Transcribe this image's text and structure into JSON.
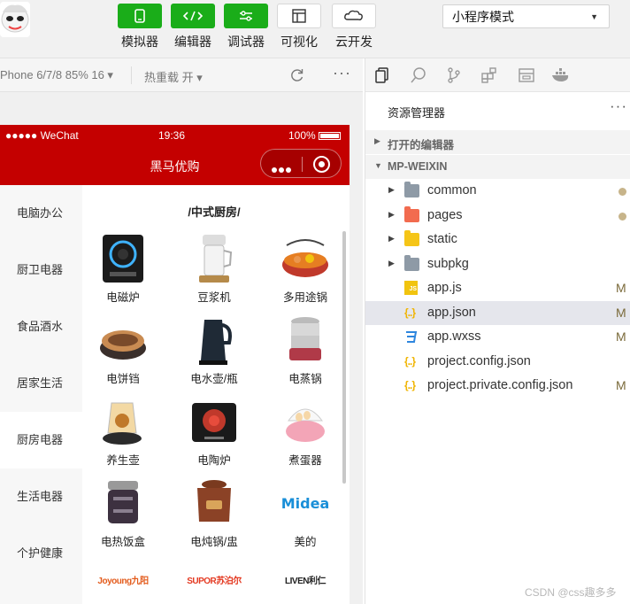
{
  "toolbar": {
    "buttons": [
      {
        "label": "模拟器",
        "icon": "phone-icon",
        "style": "green"
      },
      {
        "label": "编辑器",
        "icon": "code-icon",
        "style": "green"
      },
      {
        "label": "调试器",
        "icon": "debug-sliders-icon",
        "style": "green"
      },
      {
        "label": "可视化",
        "icon": "layout-icon",
        "style": "white"
      },
      {
        "label": "云开发",
        "icon": "cloud-icon",
        "style": "white"
      }
    ],
    "mode_select": "小程序模式"
  },
  "simulator_bar": {
    "device": "Phone 6/7/8 85% 16 ▾",
    "hot_reload": "热重载 开 ▾",
    "more": "···"
  },
  "phone": {
    "carrier": "●●●●● WeChat",
    "time": "19:36",
    "battery": "100%",
    "nav_title": "黑马优购",
    "menu": [
      "电脑办公",
      "厨卫电器",
      "食品酒水",
      "居家生活",
      "厨房电器",
      "生活电器",
      "个护健康"
    ],
    "active_menu_index": 4,
    "section_title": "/中式厨房/",
    "products": [
      {
        "label": "电磁炉"
      },
      {
        "label": "豆浆机"
      },
      {
        "label": "多用途锅"
      },
      {
        "label": "电饼铛"
      },
      {
        "label": "电水壶/瓶"
      },
      {
        "label": "电蒸锅"
      },
      {
        "label": "养生壶"
      },
      {
        "label": "电陶炉"
      },
      {
        "label": "煮蛋器"
      },
      {
        "label": "电热饭盒"
      },
      {
        "label": "电炖锅/盅"
      },
      {
        "label": "美的"
      }
    ],
    "brand_logos": [
      "Joyoung九阳",
      "SUPOR苏泊尔",
      "LIVEN利仁"
    ],
    "midea_logo": "Midea"
  },
  "explorer": {
    "title": "资源管理器",
    "more": "···",
    "open_editors": "打开的编辑器",
    "project": "MP-WEIXIN",
    "items": [
      {
        "name": "common",
        "type": "folder",
        "color": "#8e9aa6",
        "status": "dot"
      },
      {
        "name": "pages",
        "type": "folder",
        "color": "#f26b4f",
        "status": "dot"
      },
      {
        "name": "static",
        "type": "folder",
        "color": "#f5c518",
        "status": ""
      },
      {
        "name": "subpkg",
        "type": "folder",
        "color": "#8e9aa6",
        "status": ""
      },
      {
        "name": "app.js",
        "type": "js",
        "status": "M"
      },
      {
        "name": "app.json",
        "type": "json",
        "status": "M",
        "selected": true
      },
      {
        "name": "app.wxss",
        "type": "css",
        "status": "M"
      },
      {
        "name": "project.config.json",
        "type": "json",
        "status": ""
      },
      {
        "name": "project.private.config.json",
        "type": "json",
        "status": "M"
      }
    ]
  },
  "watermark": "CSDN @css趣多多"
}
